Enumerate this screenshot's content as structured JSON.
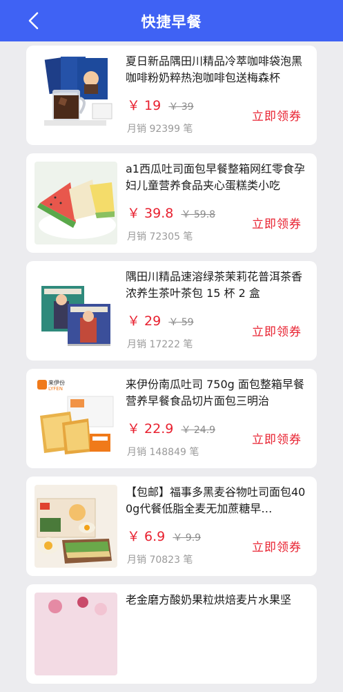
{
  "header": {
    "title": "快捷早餐",
    "back_icon": "chevron-left-icon",
    "background": "#3f62f4"
  },
  "colors": {
    "price": "#e8202f",
    "muted": "#9a9a9a"
  },
  "products": [
    {
      "name": "夏日新品隅田川精品冷萃咖啡袋泡黑咖啡粉奶粹热泡咖啡包送梅森杯",
      "price": "￥ 19",
      "original_price": "￥ 39",
      "sales": "月销 92399 笔",
      "coupon_label": "立即领券"
    },
    {
      "name": "a1西瓜吐司面包早餐整箱网红零食孕妇儿童营养食品夹心蛋糕类小吃",
      "price": "￥ 39.8",
      "original_price": "￥ 59.8",
      "sales": "月销 72305 笔",
      "coupon_label": "立即领券"
    },
    {
      "name": "隅田川精品速溶绿茶茉莉花普洱茶香浓养生茶叶茶包 15 杯 2 盒",
      "price": "￥ 29",
      "original_price": "￥ 59",
      "sales": "月销 17222 笔",
      "coupon_label": "立即领券"
    },
    {
      "name": "来伊份南瓜吐司 750g 面包整箱早餐营养早餐食品切片面包三明治",
      "price": "￥ 22.9",
      "original_price": "￥ 24.9",
      "sales": "月销 148849 笔",
      "coupon_label": "立即领券",
      "brand_text": "来伊份",
      "brand_en": "LYFEN"
    },
    {
      "name": "【包邮】福事多黑麦谷物吐司面包400g代餐低脂全麦无加蔗糖早…",
      "price": "￥ 6.9",
      "original_price": "￥ 9.9",
      "sales": "月销 70823 笔",
      "coupon_label": "立即领券"
    },
    {
      "name": "老金磨方酸奶果粒烘焙麦片水果坚",
      "price": "",
      "original_price": "",
      "sales": "",
      "coupon_label": ""
    }
  ]
}
